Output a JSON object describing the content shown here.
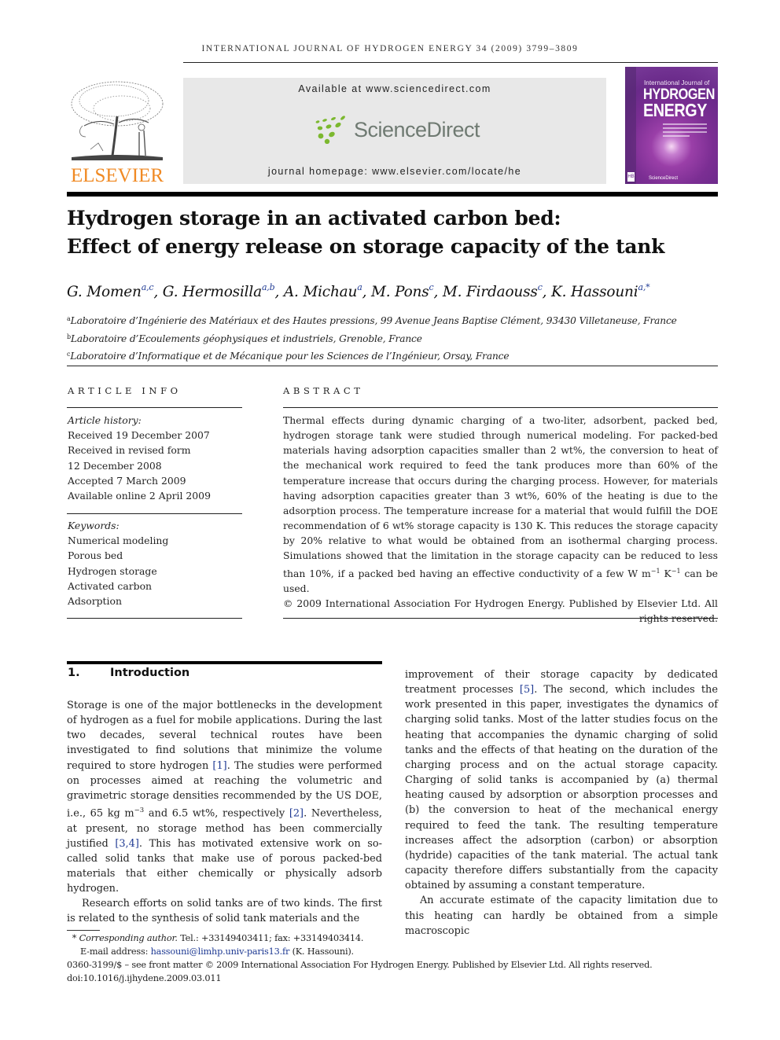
{
  "header": {
    "running_head": "INTERNATIONAL JOURNAL OF HYDROGEN ENERGY 34 (2009) 3799–3809",
    "publisher_logo_text": "ELSEVIER",
    "available_at": "Available at www.sciencedirect.com",
    "sciencedirect_logo_text": "ScienceDirect",
    "journal_homepage": "journal homepage: www.elsevier.com/locate/he",
    "cover": {
      "line1": "International Journal of",
      "line2": "HYDROGEN",
      "line3": "ENERGY",
      "footer": "ScienceDirect",
      "badge": "HB"
    },
    "colors": {
      "elsevier_orange": "#f08a24",
      "sciencedirect_green": "#7cb82f",
      "link_blue": "#1f3a93"
    }
  },
  "article": {
    "title_line1": "Hydrogen storage in an activated carbon bed:",
    "title_line2": "Effect of energy release on storage capacity of the tank",
    "authors": [
      {
        "name": "G. Momen",
        "sup": "a,c",
        "sep": ", "
      },
      {
        "name": "G. Hermosilla",
        "sup": "a,b",
        "sep": ", "
      },
      {
        "name": "A. Michau",
        "sup": "a",
        "sep": ", "
      },
      {
        "name": "M. Pons",
        "sup": "c",
        "sep": ", "
      },
      {
        "name": "M. Firdaouss",
        "sup": "c",
        "sep": ", "
      },
      {
        "name": "K. Hassouni",
        "sup": "a,*",
        "sep": ""
      }
    ],
    "affiliations": [
      {
        "key": "a",
        "text": "Laboratoire d’Ingénierie des Matériaux et des Hautes pressions, 99 Avenue Jeans Baptise Clément, 93430 Villetaneuse, France"
      },
      {
        "key": "b",
        "text": "Laboratoire d’Ecoulements géophysiques et industriels, Grenoble, France"
      },
      {
        "key": "c",
        "text": "Laboratoire d’Informatique et de Mécanique pour les Sciences de l’Ingénieur, Orsay, France"
      }
    ]
  },
  "article_info": {
    "label": "ARTICLE INFO",
    "history_label": "Article history:",
    "history": [
      "Received 19 December 2007",
      "Received in revised form",
      "12 December 2008",
      "Accepted 7 March 2009",
      "Available online 2 April 2009"
    ],
    "keywords_label": "Keywords:",
    "keywords": [
      "Numerical modeling",
      "Porous bed",
      "Hydrogen storage",
      "Activated carbon",
      "Adsorption"
    ]
  },
  "abstract": {
    "label": "ABSTRACT",
    "text_before_units": "Thermal effects during dynamic charging of a two-liter, adsorbent, packed bed, hydrogen storage tank were studied through numerical modeling. For packed-bed materials having adsorption capacities smaller than 2 wt%, the conversion to heat of the mechanical work required to feed the tank produces more than 60% of the temperature increase that occurs during the charging process. However, for materials having adsorption capacities greater than 3 wt%, 60% of the heating is due to the adsorption process. The temperature increase for a material that would fulfill the DOE recommendation of 6 wt% storage capacity is 130 K. This reduces the storage capacity by 20% relative to what would be obtained from an isothermal charging process. Simulations showed that the limitation in the storage capacity can be reduced to less than 10%, if a packed bed having an effective conductivity of a few ",
    "unit_w": "W m",
    "unit_exp1": "−1",
    "unit_k": " K",
    "unit_exp2": "−1",
    "text_after_units": " can be used.",
    "copyright": "© 2009 International Association For Hydrogen Energy. Published by Elsevier Ltd. All rights reserved."
  },
  "introduction": {
    "number": "1.",
    "heading": "Introduction",
    "p1_a": "Storage is one of the major bottlenecks in the development of hydrogen as a fuel for mobile applications. During the last two decades, several technical routes have been investigated to find solutions that minimize the volume required to store hydrogen ",
    "cite1": "[1]",
    "p1_b": ". The studies were performed on processes aimed at reaching the volumetric and gravimetric storage densities recommended by the US DOE, i.e., 65 kg m",
    "p1_exp": "−3",
    "p1_c": " and 6.5 wt%, respectively ",
    "cite2": "[2]",
    "p1_d": ". Nevertheless, at present, no storage method has been commercially justified ",
    "cite3": "[3,4]",
    "p1_e": ". This has motivated extensive work on so-called solid tanks that make use of porous packed-bed materials that either chemically or physically adsorb hydrogen.",
    "p2_a": "Research efforts on solid tanks are of two kinds. The first is related to the synthesis of solid tank materials and the improvement of their storage capacity by dedicated treatment processes ",
    "cite5": "[5]",
    "p2_b": ". The second, which includes the work presented in this paper, investigates the dynamics of charging solid tanks. Most of the latter studies focus on the heating that accompanies the dynamic charging of solid tanks and the effects of that heating on the duration of the charging process and on the actual storage capacity. Charging of solid tanks is accompanied by (a) thermal heating caused by adsorption or absorption processes and (b) the conversion to heat of the mechanical energy required to feed the tank. The resulting temperature increases affect the adsorption (carbon) or absorption (hydride) capacities of the tank material. The actual tank capacity therefore differs substantially from the capacity obtained by assuming a constant temperature.",
    "p3": "An accurate estimate of the capacity limitation due to this heating can hardly be obtained from a simple macroscopic"
  },
  "footnotes": {
    "star": "*",
    "corresponding_label": "Corresponding author.",
    "contact": " Tel.: +33149403411; fax: +33149403414.",
    "email_label": "E-mail address: ",
    "email": "hassouni@limhp.univ-paris13.fr",
    "email_owner": " (K. Hassouni).",
    "front_matter": "0360-3199/$ – see front matter © 2009 International Association For Hydrogen Energy. Published by Elsevier Ltd. All rights reserved.",
    "doi": "doi:10.1016/j.ijhydene.2009.03.011"
  }
}
